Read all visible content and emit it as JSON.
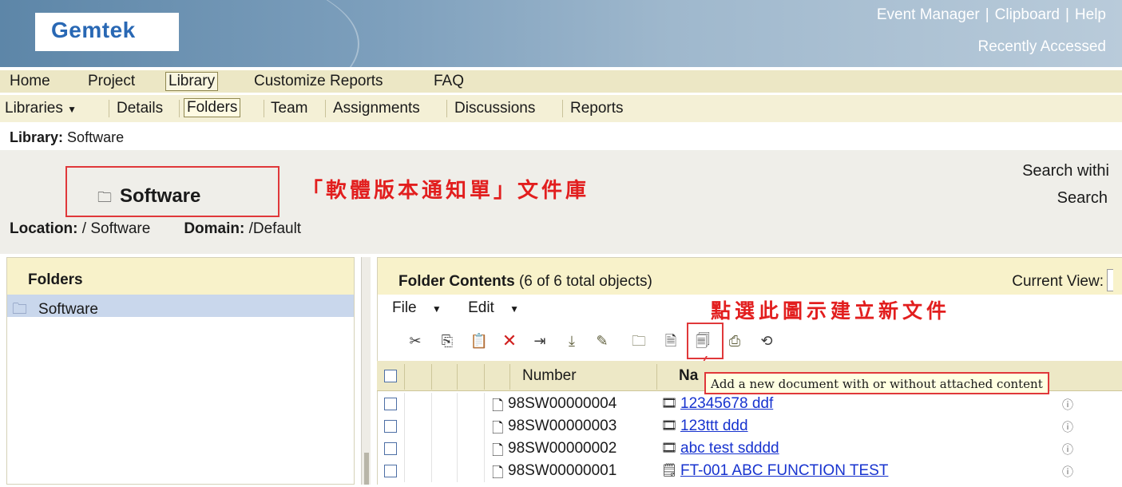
{
  "header": {
    "logo": "Gemtek",
    "links": [
      "Event Manager",
      "Clipboard",
      "Help"
    ],
    "recently_accessed": "Recently Accessed"
  },
  "top_nav": [
    "Home",
    "Project",
    "Library",
    "Customize Reports",
    "FAQ"
  ],
  "top_nav_active": "Library",
  "sub_nav": [
    "Libraries",
    "Details",
    "Folders",
    "Team",
    "Assignments",
    "Discussions",
    "Reports"
  ],
  "sub_nav_active": "Folders",
  "library_line": {
    "label": "Library:",
    "value": "Software"
  },
  "object": {
    "title": "Software",
    "location_label": "Location:",
    "location": "/ Software",
    "domain_label": "Domain:",
    "domain": "/Default"
  },
  "annotations": {
    "library_note": "「軟體版本通知單」文件庫",
    "icon_note": "點選此圖示建立新文件"
  },
  "search": {
    "within": "Search withi",
    "label": "Search"
  },
  "folders": {
    "title": "Folders",
    "items": [
      "Software"
    ]
  },
  "contents": {
    "title": "Folder Contents",
    "subtitle": "(6 of 6 total objects)",
    "current_view_label": "Current View:",
    "menus": [
      "File",
      "Edit"
    ],
    "tooltip": "Add a new document with or without attached content"
  },
  "toolbar_icons": [
    "cut-icon",
    "copy-icon",
    "paste-icon",
    "delete-icon",
    "move-icon",
    "check-in-icon",
    "rename-icon",
    "new-folder-icon",
    "new-document-icon",
    "new-from-template-icon",
    "new-part-icon",
    "import-icon"
  ],
  "table": {
    "columns": [
      "Number",
      "Na"
    ],
    "rows": [
      {
        "number": "98SW00000004",
        "name": "12345678 ddf"
      },
      {
        "number": "98SW00000003",
        "name": "123ttt ddd"
      },
      {
        "number": "98SW00000002",
        "name": "abc test sdddd"
      },
      {
        "number": "98SW00000001",
        "name": "FT-001 ABC FUNCTION TEST"
      }
    ]
  },
  "colors": {
    "annotation_red": "#e21e1e",
    "link_blue": "#1733cf",
    "header_blue": "#5d86a8"
  }
}
